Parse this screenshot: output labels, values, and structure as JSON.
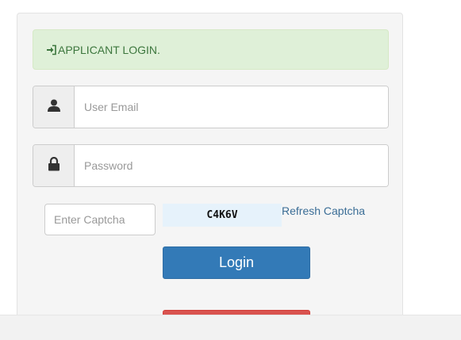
{
  "alert": {
    "icon": "sign-in-icon",
    "text": "APPLICANT LOGIN."
  },
  "email": {
    "icon": "user-icon",
    "placeholder": "User Email",
    "value": ""
  },
  "password": {
    "icon": "lock-icon",
    "placeholder": "Password",
    "value": ""
  },
  "captcha": {
    "placeholder": "Enter Captcha",
    "code": "C4K6V",
    "refresh_label": "Refresh Captcha"
  },
  "buttons": {
    "login_label": "Login"
  },
  "colors": {
    "primary": "#337ab7",
    "danger": "#d9534f",
    "success_bg": "#dff0d8",
    "success_text": "#3c763d",
    "link": "#3a6d96"
  }
}
